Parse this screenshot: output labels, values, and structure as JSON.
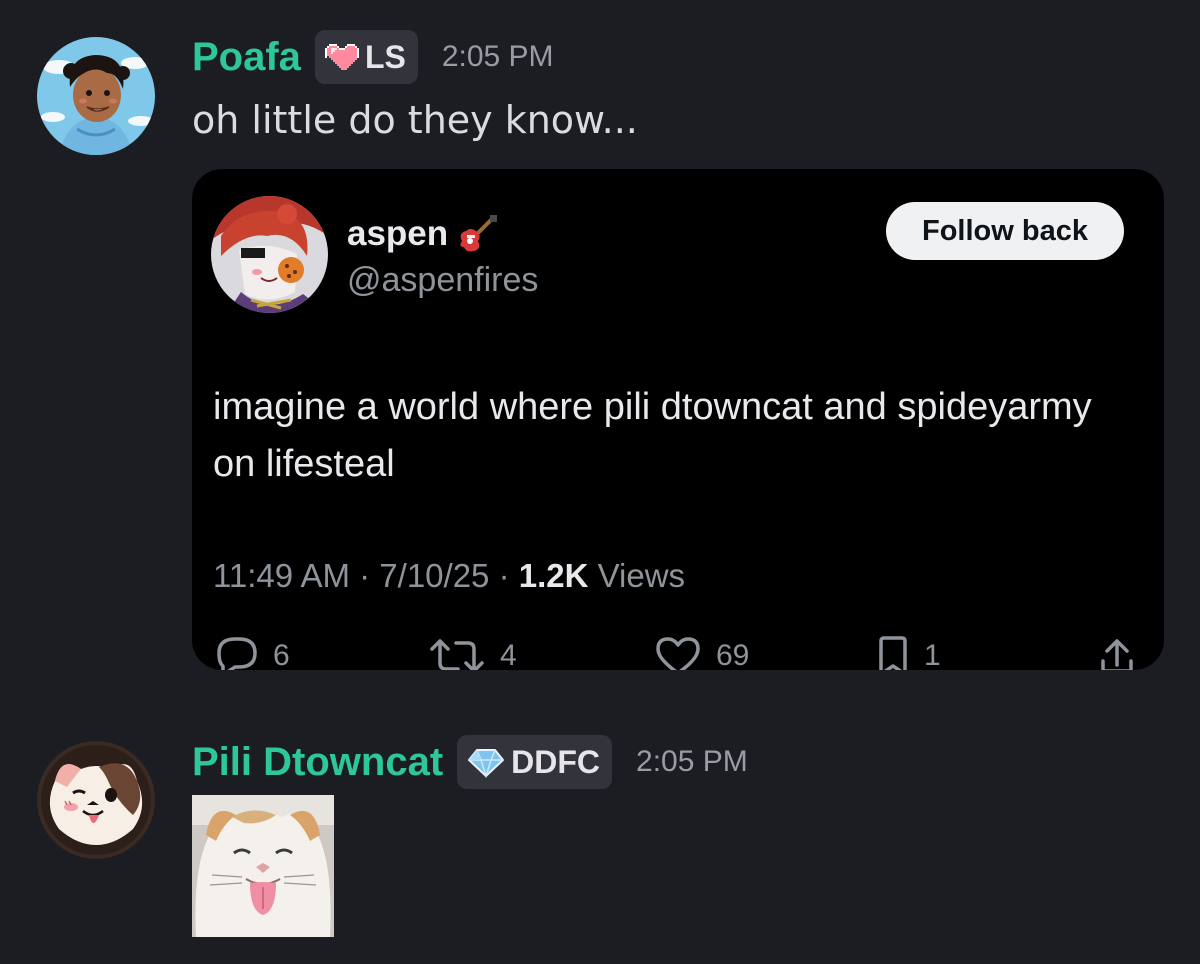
{
  "messages": [
    {
      "username": "Poafa",
      "tag": "LS",
      "tag_icon": "heart-pixel-icon",
      "timestamp": "2:05 PM",
      "text": "oh little do they know...",
      "embed": {
        "display_name": "aspen",
        "name_emoji": "guitar-icon",
        "handle": "@aspenfires",
        "follow_label": "Follow back",
        "body": "imagine a world where pili dtowncat and spideyarmy on lifesteal",
        "meta_prefix": "11:49 AM · 7/10/25 · ",
        "views_count": "1.2K",
        "views_label": " Views",
        "actions": {
          "replies": "6",
          "reposts": "4",
          "likes": "69",
          "bookmarks": "1"
        }
      }
    },
    {
      "username": "Pili Dtowncat",
      "tag": "DDFC",
      "tag_icon": "diamond-icon",
      "timestamp": "2:05 PM",
      "attachment": "cat-tongue-image"
    }
  ],
  "colors": {
    "background": "#1c1d22",
    "username": "#2dc79a",
    "tag_bg": "#33343b",
    "embed_bg": "#000000",
    "muted": "#8f949a"
  }
}
